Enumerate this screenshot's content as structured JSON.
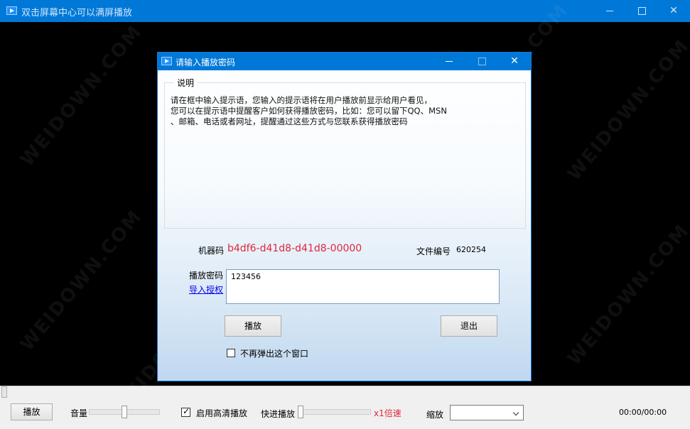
{
  "window": {
    "title": "双击屏幕中心可以满屏播放",
    "minimize_icon": "minimize-icon",
    "maximize_icon": "maximize-icon",
    "close_icon": "close-icon"
  },
  "watermark": "WEIDOWN.COM",
  "dialog": {
    "title": "请输入播放密码",
    "group_label": "说明",
    "description_lines": [
      "请在框中输入提示语，您输入的提示语将在用户播放前显示给用户看见，",
      "您可以在提示语中提醒客户如何获得播放密码，比如：您可以留下QQ、MSN",
      "、邮箱、电话或者网址，提醒通过这些方式与您联系获得播放密码"
    ],
    "machine_code_label": "机器码",
    "machine_code": "b4df6-d41d8-d41d8-00000",
    "file_no_label": "文件编号",
    "file_no": "620254",
    "password_label": "播放密码",
    "import_link": "导入授权",
    "password_value": "123456",
    "play_button": "播放",
    "exit_button": "退出",
    "no_popup_label": "不再弹出这个窗口",
    "no_popup_checked": false
  },
  "controls": {
    "play_button": "播放",
    "volume_label": "音量",
    "hd_label": "启用高清播放",
    "hd_checked": true,
    "fast_label": "快进播放",
    "speed_value": "x1倍速",
    "zoom_label": "缩放",
    "zoom_value": "",
    "time": "00:00/00:00"
  },
  "colors": {
    "title_bar": "#0078d7",
    "accent_red": "#e0263c"
  }
}
